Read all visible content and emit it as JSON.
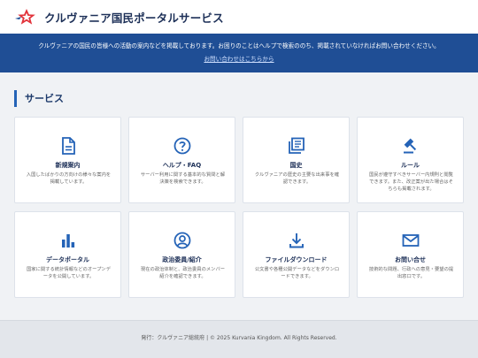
{
  "header": {
    "site_title": "クルヴァニア国民ポータルサービス",
    "logo": "star-logo-icon"
  },
  "banner": {
    "text": "クルヴァニアの国民の皆様への活動の案内などを掲載しております。お困りのことはヘルプで検索ののち、掲載されていなければお問い合わせください。",
    "link_text": "お問い合わせはこちらから"
  },
  "section": {
    "heading": "サービス"
  },
  "cards": [
    {
      "title": "新規案内",
      "desc": "入国したばかりの方向けの様々な案内を掲載しています。",
      "icon": "document-icon"
    },
    {
      "title": "ヘルプ・FAQ",
      "desc": "サーバー利用に関する基本的な質問と解決策を検索できます。",
      "icon": "help-circle-icon"
    },
    {
      "title": "国史",
      "desc": "クルヴァニアの歴史の主要な出来事を確認できます。",
      "icon": "history-book-icon"
    },
    {
      "title": "ルール",
      "desc": "国民が遵守すべきサーバー内規則と閲覧できます。また、改正案が出た場合はそちらも掲載されます。",
      "icon": "gavel-icon"
    },
    {
      "title": "データポータル",
      "desc": "国家に関する統計情報などのオープンデータを公開しています。",
      "icon": "bar-chart-icon"
    },
    {
      "title": "政治委員/紹介",
      "desc": "現在の政治体制と、政治委員のメンバー紹介を確認できます。",
      "icon": "person-circle-icon"
    },
    {
      "title": "ファイルダウンロード",
      "desc": "公文書や各種公開データなどをダウンロードできます。",
      "icon": "download-icon"
    },
    {
      "title": "お問い合せ",
      "desc": "技術的な問題、行政への意見・要望の提出窓口です。",
      "icon": "mail-icon"
    }
  ],
  "footer": {
    "text": "発行：クルヴァニア総統府 | © 2025 Kurvania Kingdom. All Rights Reserved."
  },
  "colors": {
    "brand": "#1f4e95",
    "accent": "#2463b7",
    "title": "#1c2f57"
  }
}
